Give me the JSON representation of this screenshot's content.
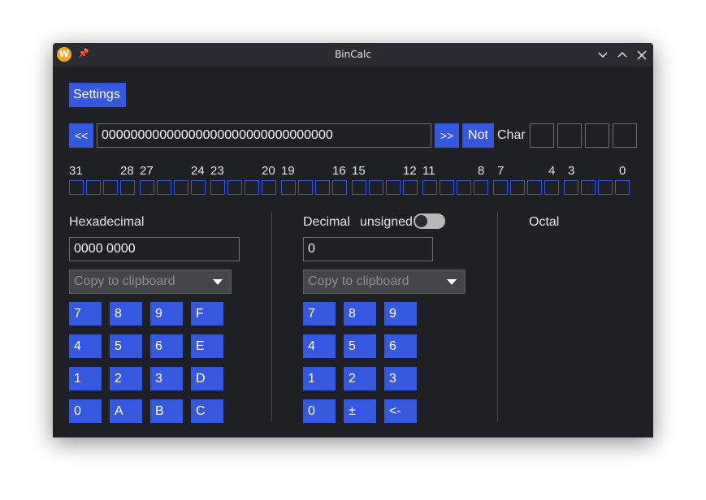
{
  "window": {
    "title": "BinCalc",
    "app_icon": "W"
  },
  "toolbar": {
    "settings_label": "Settings"
  },
  "binary": {
    "shift_left": "<<",
    "value": "00000000000000000000000000000000",
    "shift_right": ">>",
    "not_label": "Not",
    "char_label": "Char"
  },
  "bit_labels": [
    "31",
    "28",
    "27",
    "24",
    "23",
    "20",
    "19",
    "16",
    "15",
    "12",
    "11",
    "8",
    "7",
    "4",
    "3",
    "0"
  ],
  "hex": {
    "title": "Hexadecimal",
    "value": "0000 0000",
    "dropdown": "Copy to clipboard",
    "keys": [
      [
        "7",
        "8",
        "9",
        "F"
      ],
      [
        "4",
        "5",
        "6",
        "E"
      ],
      [
        "1",
        "2",
        "3",
        "D"
      ],
      [
        "0",
        "A",
        "B",
        "C"
      ]
    ]
  },
  "dec": {
    "title": "Decimal",
    "unsigned_label": "unsigned",
    "unsigned_on": false,
    "value": "0",
    "dropdown": "Copy to clipboard",
    "keys": [
      [
        "7",
        "8",
        "9"
      ],
      [
        "4",
        "5",
        "6"
      ],
      [
        "1",
        "2",
        "3"
      ],
      [
        "0",
        "±",
        "<-"
      ]
    ]
  },
  "oct": {
    "title": "Octal"
  },
  "colors": {
    "accent": "#3558e0",
    "background": "#1f2024"
  }
}
